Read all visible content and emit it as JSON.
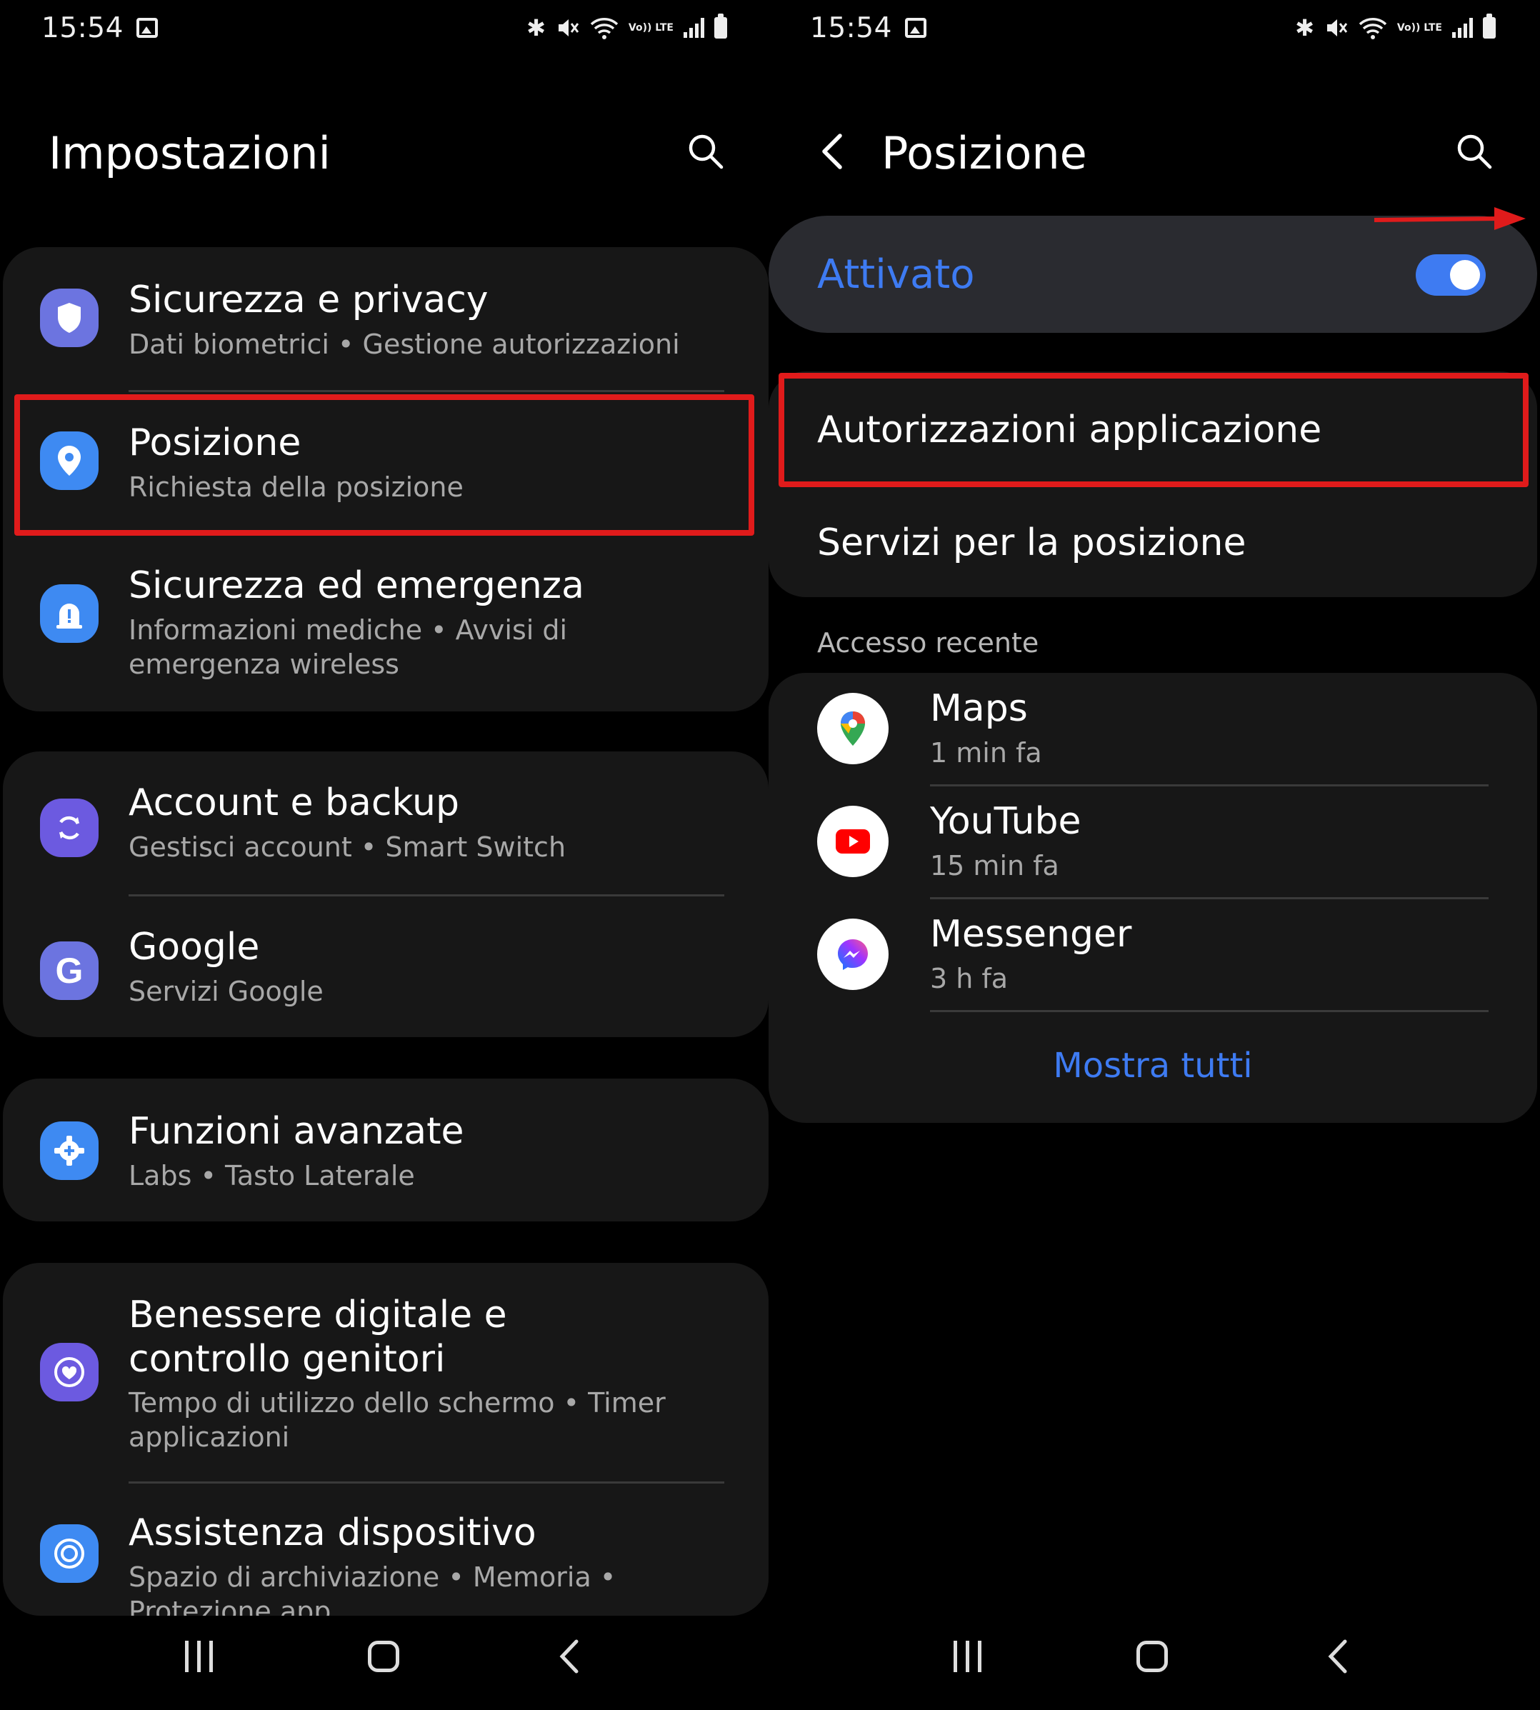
{
  "status_bar": {
    "time": "15:54",
    "volte": "Vo)) LTE"
  },
  "settings": {
    "title": "Impostazioni",
    "items": [
      {
        "label": "Sicurezza e privacy",
        "sub": "Dati biometrici  •  Gestione autorizzazioni"
      },
      {
        "label": "Posizione",
        "sub": "Richiesta della posizione"
      },
      {
        "label": "Sicurezza ed emergenza",
        "sub": "Informazioni mediche  •  Avvisi di emergenza wireless"
      },
      {
        "label": "Account e backup",
        "sub": "Gestisci account  •  Smart Switch"
      },
      {
        "label": "Google",
        "sub": "Servizi Google"
      },
      {
        "label": "Funzioni avanzate",
        "sub": "Labs  •  Tasto Laterale"
      },
      {
        "label": "Benessere digitale e controllo genitori",
        "sub": "Tempo di utilizzo dello schermo  •  Timer applicazioni"
      },
      {
        "label": "Assistenza dispositivo",
        "sub": "Spazio di archiviazione  •  Memoria  •  Protezione app"
      }
    ],
    "icon_colors": {
      "security": "#6c74e0",
      "location": "#3e8af2",
      "emergency": "#3e8af2",
      "accounts": "#6c5ae0",
      "google": "#6c74e0",
      "advanced": "#3e8af2",
      "wellbeing": "#6c5ae0",
      "care": "#3e8af2"
    }
  },
  "location": {
    "title": "Posizione",
    "toggle_label": "Attivato",
    "toggle_on": true,
    "menu": [
      {
        "label": "Autorizzazioni applicazione"
      },
      {
        "label": "Servizi per la posizione"
      }
    ],
    "recent_header": "Accesso recente",
    "recent": [
      {
        "name": "Maps",
        "time": "1 min fa"
      },
      {
        "name": "YouTube",
        "time": "15 min fa"
      },
      {
        "name": "Messenger",
        "time": "3 h fa"
      }
    ],
    "show_all": "Mostra tutti",
    "accent": "#3e7bf2",
    "highlight_color": "#e01b1b"
  }
}
